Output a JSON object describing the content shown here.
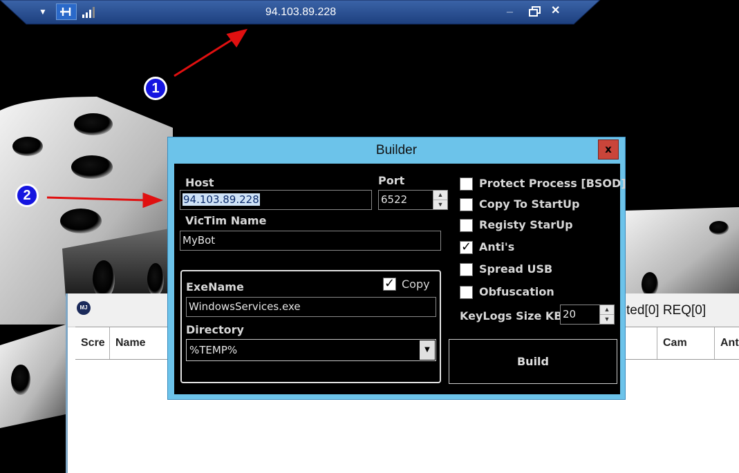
{
  "rdp_bar": {
    "ip": "94.103.89.228",
    "pin_icon": "pin-icon",
    "signal_icon": "signal-icon",
    "menu_icon": "chevron-down-icon",
    "minimize_label": "_",
    "restore_icon": "restore-icon",
    "close_label": "✕"
  },
  "main_window": {
    "logo_text": "MJ",
    "status": "ted[0] REQ[0]",
    "columns": [
      "Scre",
      "Name",
      "Cam",
      "Anti"
    ]
  },
  "builder": {
    "title": "Builder",
    "close_label": "x",
    "host_label": "Host",
    "host_value": "94.103.89.228",
    "port_label": "Port",
    "port_value": "6522",
    "victim_label": "VicTim Name",
    "victim_value": "MyBot",
    "exename_label": "ExeName",
    "exename_value": "WindowsServices.exe",
    "copy_label": "Copy",
    "copy_checked": true,
    "directory_label": "Directory",
    "directory_value": "%TEMP%",
    "options": [
      {
        "label": "Protect Process [BSOD]",
        "checked": false
      },
      {
        "label": "Copy To StartUp",
        "checked": false
      },
      {
        "label": "Registy StarUp",
        "checked": false
      },
      {
        "label": "Anti's",
        "checked": true
      },
      {
        "label": "Spread USB",
        "checked": false
      },
      {
        "label": "Obfuscation",
        "checked": false
      }
    ],
    "keylogs_label": "KeyLogs Size KB",
    "keylogs_value": "20",
    "build_label": "Build"
  },
  "annotations": {
    "marker_1": "1",
    "marker_2": "2",
    "arrow_color": "#e01010",
    "marker_color": "#1515e0"
  }
}
